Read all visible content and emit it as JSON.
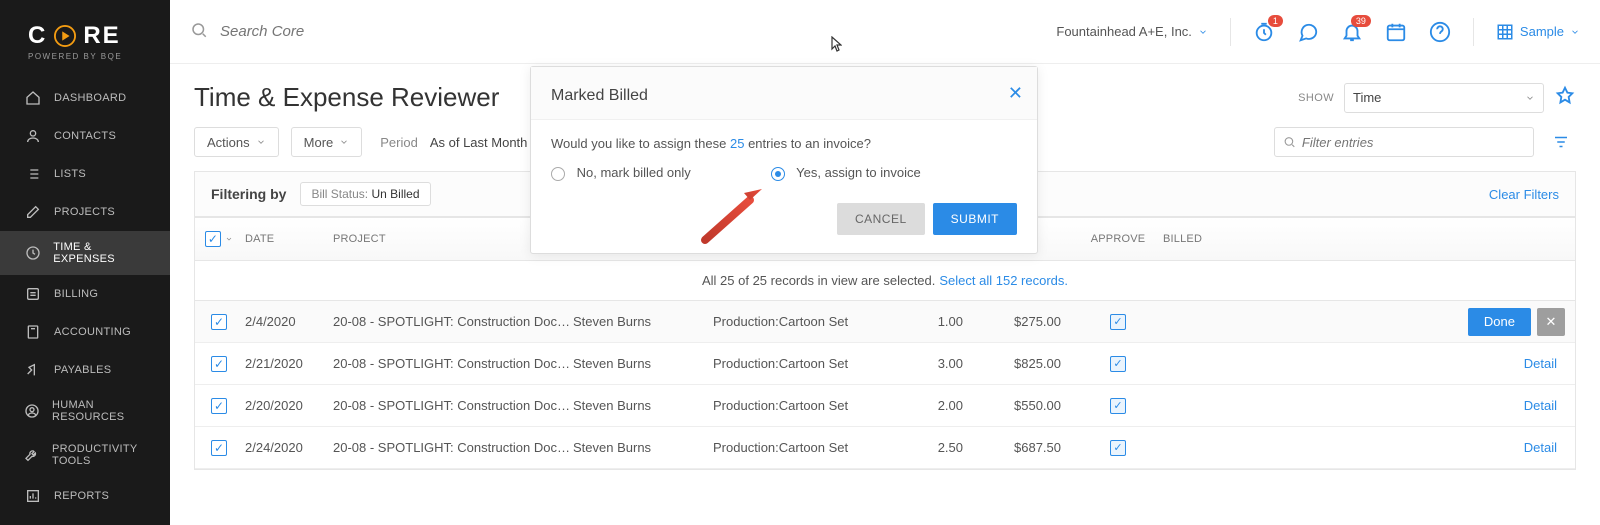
{
  "app": {
    "logo_text": "C   RE",
    "logo_sub": "POWERED BY BQE",
    "search_placeholder": "Search Core",
    "company": "Fountainhead A+E, Inc.",
    "sample": "Sample",
    "badges": {
      "clock": "1",
      "bell": "39"
    }
  },
  "sidebar": {
    "items": [
      {
        "label": "DASHBOARD"
      },
      {
        "label": "CONTACTS"
      },
      {
        "label": "LISTS"
      },
      {
        "label": "PROJECTS"
      },
      {
        "label": "TIME & EXPENSES"
      },
      {
        "label": "BILLING"
      },
      {
        "label": "ACCOUNTING"
      },
      {
        "label": "PAYABLES"
      },
      {
        "label": "HUMAN RESOURCES"
      },
      {
        "label": "PRODUCTIVITY TOOLS"
      },
      {
        "label": "REPORTS"
      }
    ]
  },
  "page": {
    "title": "Time & Expense Reviewer",
    "show_label": "SHOW",
    "show_value": "Time",
    "actions": "Actions",
    "more": "More",
    "period_label": "Period",
    "period_value": "As of Last Month",
    "filter_placeholder": "Filter entries",
    "filtering_by": "Filtering by",
    "chip_key": "Bill Status:",
    "chip_val": "Un Billed",
    "clear_filters": "Clear Filters"
  },
  "table": {
    "headers": {
      "date": "DATE",
      "project": "PROJECT",
      "approve": "APPROVE",
      "billed": "BILLED"
    },
    "banner_prefix": "All 25 of 25 records in view are selected.",
    "banner_link": "Select all 152 records.",
    "done": "Done",
    "detail": "Detail",
    "rows": [
      {
        "date": "2/4/2020",
        "project": "20-08 - SPOTLIGHT: Construction Docu…",
        "resource": "Steven Burns",
        "activity": "Production:Cartoon Set",
        "hours": "1.00",
        "amount": "$275.00"
      },
      {
        "date": "2/21/2020",
        "project": "20-08 - SPOTLIGHT: Construction Docu…",
        "resource": "Steven Burns",
        "activity": "Production:Cartoon Set",
        "hours": "3.00",
        "amount": "$825.00"
      },
      {
        "date": "2/20/2020",
        "project": "20-08 - SPOTLIGHT: Construction Docu…",
        "resource": "Steven Burns",
        "activity": "Production:Cartoon Set",
        "hours": "2.00",
        "amount": "$550.00"
      },
      {
        "date": "2/24/2020",
        "project": "20-08 - SPOTLIGHT: Construction Docu…",
        "resource": "Steven Burns",
        "activity": "Production:Cartoon Set",
        "hours": "2.50",
        "amount": "$687.50"
      }
    ]
  },
  "modal": {
    "title": "Marked Billed",
    "prompt_pre": "Would you like to assign these ",
    "count": "25",
    "prompt_post": " entries to an invoice?",
    "opt_no": "No, mark billed only",
    "opt_yes": "Yes, assign to invoice",
    "cancel": "CANCEL",
    "submit": "SUBMIT"
  }
}
